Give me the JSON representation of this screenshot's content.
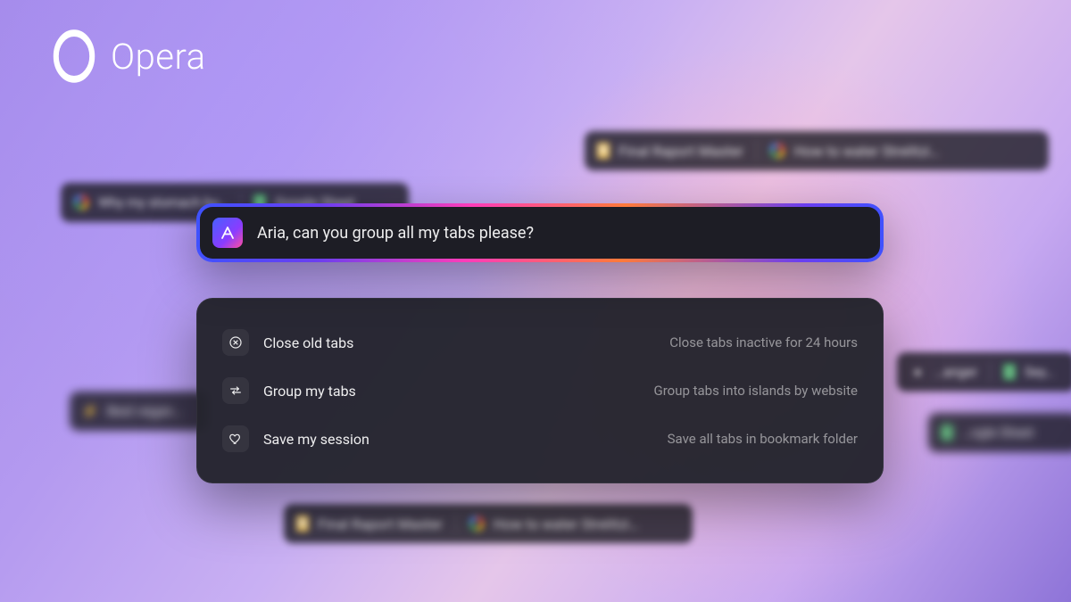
{
  "brand": {
    "name": "Opera"
  },
  "command": {
    "prompt": "Aria, can you group all my tabs please?"
  },
  "suggestions": [
    {
      "title": "Close old tabs",
      "description": "Close tabs inactive for 24 hours",
      "icon": "close-circle-icon"
    },
    {
      "title": "Group my tabs",
      "description": "Group tabs into islands by website",
      "icon": "swap-icon"
    },
    {
      "title": "Save my session",
      "description": "Save all tabs in bookmark folder",
      "icon": "heart-icon"
    }
  ],
  "background_tabs": {
    "top_right": [
      {
        "icon": "doc-yellow",
        "label": "Final Raport Master"
      },
      {
        "icon": "google",
        "label": "How to water Strelitzi…"
      }
    ],
    "upper_left": [
      {
        "icon": "google",
        "label": "Why my stomach bu…"
      },
      {
        "icon": "doc-green",
        "label": "Google Sheet"
      }
    ],
    "mid_left": [
      {
        "icon": "zap",
        "label": "Best vegan…"
      }
    ],
    "mid_right_a": [
      {
        "icon": "generic",
        "label": "…anger"
      }
    ],
    "mid_right_b": [
      {
        "icon": "doc-green",
        "label": "…ogle Sheet"
      }
    ],
    "bottom": [
      {
        "icon": "doc-yellow",
        "label": "Final Raport Master"
      },
      {
        "icon": "google",
        "label": "How to water Strelitzi…"
      }
    ]
  }
}
